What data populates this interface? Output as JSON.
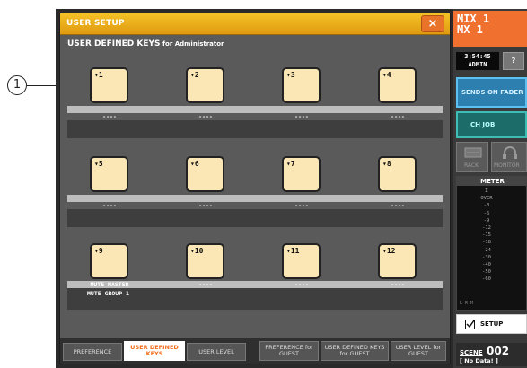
{
  "callout": {
    "number": "1"
  },
  "dialog": {
    "title": "USER SETUP",
    "close_symbol": "×",
    "heading": "USER DEFINED KEYS",
    "heading_sub": " for Administrator"
  },
  "rows": [
    {
      "keys": [
        "▾1",
        "▾2",
        "▾3",
        "▾4"
      ],
      "assignments": [
        "----",
        "----",
        "----",
        "----"
      ],
      "panel_text": ""
    },
    {
      "keys": [
        "▾5",
        "▾6",
        "▾7",
        "▾8"
      ],
      "assignments": [
        "----",
        "----",
        "----",
        "----"
      ],
      "panel_text": ""
    },
    {
      "keys": [
        "▾9",
        "▾10",
        "▾11",
        "▾12"
      ],
      "assignments": [
        "MUTE MASTER",
        "----",
        "----",
        "----"
      ],
      "panel_text": "MUTE GROUP 1"
    }
  ],
  "tabs": {
    "preference": "PREFERENCE",
    "user_defined_keys": "USER DEFINED KEYS",
    "user_level": "USER LEVEL",
    "preference_guest": "PREFERENCE for GUEST",
    "user_defined_keys_guest": "USER DEFINED KEYS for GUEST",
    "user_level_guest": "USER LEVEL for GUEST"
  },
  "sidebar": {
    "mix": "MIX 1\nMX 1",
    "time": "3:54:45",
    "user": "ADMIN",
    "help": "?",
    "sends_on_fader": "SENDS ON FADER",
    "ch_job": "CH JOB",
    "rack": "RACK",
    "monitor": "MONITOR",
    "meter_title": "METER",
    "meter_scale": [
      "Σ",
      "OVER",
      "-3",
      "-6",
      "-9",
      "-12",
      "-15",
      "-18",
      "-24",
      "-30",
      "-40",
      "-50",
      "-60"
    ],
    "meter_lr": "L  R  M",
    "setup": "SETUP",
    "scene_label": "SCENE",
    "scene_number": "002",
    "scene_name": "[  No Data!  ]"
  },
  "colors": {
    "title_bar": "#f0b020",
    "key": "#fbe6b6",
    "active_tab_text": "#f37020",
    "mix": "#f07030"
  }
}
